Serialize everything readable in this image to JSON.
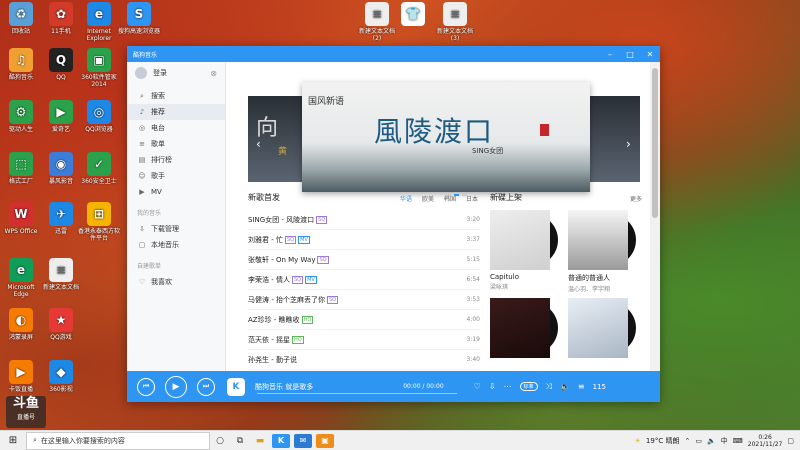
{
  "desktop": {
    "icons": [
      {
        "label": "回收站",
        "icon": "recycle-bin-icon",
        "color": "#5aa0d8",
        "glyph": "♻"
      },
      {
        "label": "11手机",
        "icon": "phone-app-icon",
        "color": "#d23a2a",
        "glyph": "✿"
      },
      {
        "label": "Internet Explorer",
        "icon": "ie-icon",
        "color": "#1e88e5",
        "glyph": "e"
      },
      {
        "label": "搜狗高速浏览器",
        "icon": "sogou-browser-icon",
        "color": "#2f95f3",
        "glyph": "S"
      },
      {
        "label": "新建文本文档(2)",
        "icon": "text-file-icon",
        "color": "#eeeeee",
        "glyph": "≡"
      },
      {
        "label": "",
        "icon": "tshirt-icon",
        "color": "#ffffff",
        "glyph": "👕"
      },
      {
        "label": "新建文本文档(3)",
        "icon": "text-file-icon",
        "color": "#eeeeee",
        "glyph": "≡"
      },
      {
        "label": "酷狗音乐",
        "icon": "music-store-icon",
        "color": "#f0a030",
        "glyph": "♫"
      },
      {
        "label": "QQ",
        "icon": "qq-icon",
        "color": "#222222",
        "glyph": "Q"
      },
      {
        "label": "360软件管家2014",
        "icon": "software-manager-icon",
        "color": "#2aa14a",
        "glyph": "▣"
      },
      {
        "label": "驱动人生",
        "icon": "driver-icon",
        "color": "#2aa14a",
        "glyph": "⚙"
      },
      {
        "label": "爱奇艺",
        "icon": "iqiyi-icon",
        "color": "#2aa14a",
        "glyph": "▶"
      },
      {
        "label": "QQ浏览器",
        "icon": "qq-browser-icon",
        "color": "#1e88e5",
        "glyph": "◎"
      },
      {
        "label": "格式工厂",
        "icon": "format-factory-icon",
        "color": "#2aa14a",
        "glyph": "⬚"
      },
      {
        "label": "暴风影音",
        "icon": "video-player-icon",
        "color": "#3b7dd8",
        "glyph": "◉"
      },
      {
        "label": "360安全卫士",
        "icon": "security-icon",
        "color": "#2aa14a",
        "glyph": "✓"
      },
      {
        "label": "WPS Office",
        "icon": "wps-icon",
        "color": "#d32f2f",
        "glyph": "W"
      },
      {
        "label": "迅雷",
        "icon": "xunlei-icon",
        "color": "#1e88e5",
        "glyph": "✈"
      },
      {
        "label": "香港永泰西方软件平台",
        "icon": "windows-software-icon",
        "color": "#f4b400",
        "glyph": "⊞"
      },
      {
        "label": "Microsoft Edge",
        "icon": "edge-icon",
        "color": "#0f9d58",
        "glyph": "e"
      },
      {
        "label": "新建文本文档",
        "icon": "text-file-icon",
        "color": "#eeeeee",
        "glyph": "≡"
      },
      {
        "label": "鸿蒙录屏",
        "icon": "screen-record-icon",
        "color": "#f57c00",
        "glyph": "◐"
      },
      {
        "label": "QQ游戏",
        "icon": "qq-game-icon",
        "color": "#e53935",
        "glyph": "★"
      },
      {
        "label": "卡饭直播",
        "icon": "live-icon",
        "color": "#f57c00",
        "glyph": "▶"
      },
      {
        "label": "360影视",
        "icon": "video-icon",
        "color": "#1e88e5",
        "glyph": "◆"
      }
    ]
  },
  "watermark": {
    "line1": "斗鱼",
    "line2": "直播号"
  },
  "app": {
    "title": "酷狗音乐",
    "login_label": "登录",
    "nav": [
      {
        "label": "搜索",
        "icon": "search-icon",
        "glyph": "⌕"
      },
      {
        "label": "推荐",
        "icon": "recommend-icon",
        "glyph": "♪"
      },
      {
        "label": "电台",
        "icon": "radio-icon",
        "glyph": "◎"
      },
      {
        "label": "歌单",
        "icon": "playlist-icon",
        "glyph": "≡"
      },
      {
        "label": "排行榜",
        "icon": "chart-icon",
        "glyph": "▤"
      },
      {
        "label": "歌手",
        "icon": "singer-icon",
        "glyph": "☺"
      },
      {
        "label": "MV",
        "icon": "mv-icon",
        "glyph": "▶"
      }
    ],
    "section_my_music": "我的音乐",
    "my_music": [
      {
        "label": "下载管理",
        "icon": "download-icon",
        "glyph": "⇩"
      },
      {
        "label": "本地音乐",
        "icon": "local-music-icon",
        "glyph": "▢"
      }
    ],
    "section_created": "自建歌单",
    "created": [
      {
        "label": "我喜欢",
        "icon": "heart-icon",
        "glyph": "♡"
      }
    ],
    "banner": {
      "tag": "国风新语",
      "title": "風陵渡口",
      "singer": "SING女团",
      "side_left": "向",
      "side_left_sub": "黄"
    },
    "new_songs": {
      "heading": "新歌首发",
      "tabs": [
        "华语",
        "欧美",
        "韩国",
        "日本"
      ],
      "songs": [
        {
          "title": "SING女团 - 风陵渡口",
          "tags": [
            {
              "t": "SQ",
              "k": "h"
            }
          ],
          "dur": "3:20"
        },
        {
          "title": "刘雅君 - 忙",
          "tags": [
            {
              "t": "SQ",
              "k": "h"
            },
            {
              "t": "MV",
              "k": "m"
            }
          ],
          "dur": "3:37"
        },
        {
          "title": "张敬轩 - On My Way",
          "tags": [
            {
              "t": "SQ",
              "k": "h"
            }
          ],
          "dur": "5:15"
        },
        {
          "title": "李荣浩 - 情人",
          "tags": [
            {
              "t": "SQ",
              "k": "h"
            },
            {
              "t": "MV",
              "k": "m"
            }
          ],
          "dur": "6:54"
        },
        {
          "title": "马健涛 - 抬个芝麻丢了你",
          "tags": [
            {
              "t": "SQ",
              "k": "h"
            }
          ],
          "dur": "3:53"
        },
        {
          "title": "AZ珍珍 - 瞧瞧收",
          "tags": [
            {
              "t": "HQ",
              "k": "g"
            }
          ],
          "dur": "4:00"
        },
        {
          "title": "范天依 - 摇星",
          "tags": [
            {
              "t": "HQ",
              "k": "g"
            }
          ],
          "dur": "3:19"
        },
        {
          "title": "孙尧生 - 勤子说",
          "tags": [],
          "dur": "3:40"
        }
      ]
    },
    "new_albums": {
      "heading": "新碟上架",
      "more": "更多",
      "albums": [
        {
          "name": "Capitulo",
          "artist": "梁咏琪"
        },
        {
          "name": "普通的普通人",
          "artist": "温心羽、李宇翔"
        },
        {
          "name": "",
          "artist": ""
        },
        {
          "name": "",
          "artist": ""
        }
      ]
    },
    "player": {
      "now_playing": "酷狗音乐 就是歌多",
      "time": "00:00 / 00:00",
      "quality": "标准",
      "volume": "115"
    }
  },
  "taskbar": {
    "search_placeholder": "在这里输入你要搜索的内容",
    "weather": "19°C 晴朗",
    "ime": "中",
    "time": "0:26",
    "date": "2021/11/27"
  }
}
